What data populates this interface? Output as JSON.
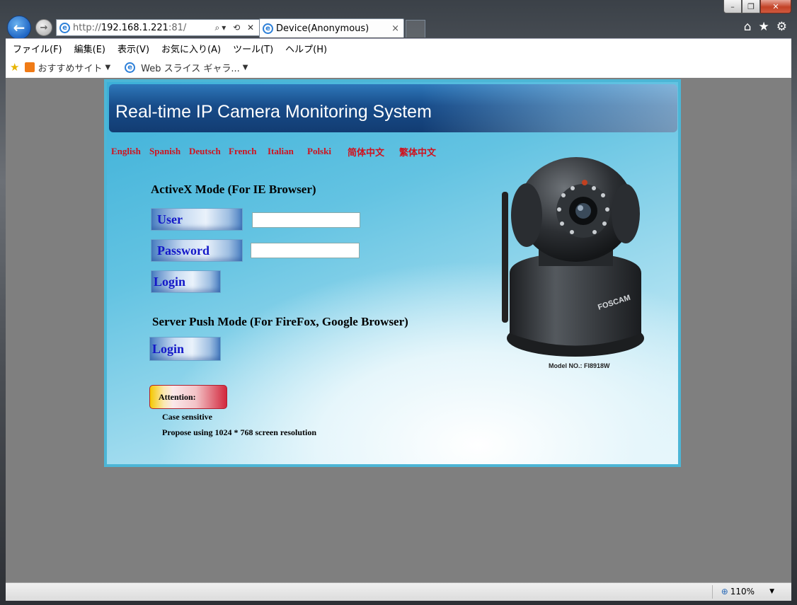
{
  "window": {
    "controls": {
      "minimize": "–",
      "restore": "❐",
      "close": "✕"
    }
  },
  "nav": {
    "address_prefix": "http://",
    "address_host": "192.168.1.221",
    "address_suffix": ":81/",
    "address_actions": "⌕▾ ⟲ ✕",
    "tab_title": "Device(Anonymous)",
    "tab_close": "×",
    "right_tools": [
      "⌂",
      "★",
      "⚙"
    ]
  },
  "menu": [
    "ファイル(F)",
    "編集(E)",
    "表示(V)",
    "お気に入り(A)",
    "ツール(T)",
    "ヘルプ(H)"
  ],
  "favorites": {
    "item1": "おすすめサイト",
    "item2": "Web スライス ギャラ..."
  },
  "page": {
    "banner_title": "Real-time IP Camera Monitoring System",
    "languages": [
      "English",
      "Spanish",
      "Deutsch",
      "French",
      "Italian",
      "Polski",
      "简体中文",
      "繁体中文"
    ],
    "activex_heading": "ActiveX Mode (For IE Browser)",
    "user_label": "User",
    "password_label": "Password",
    "user_value": "",
    "password_value": "",
    "login_label": "Login",
    "serverpush_heading": "Server Push Mode (For FireFox, Google Browser)",
    "login2_label": "Login",
    "attention_label": "Attention:",
    "note1": "Case sensitive",
    "note2": "Propose using 1024 * 768 screen resolution",
    "camera_brand": "FOSCAM",
    "camera_model": "Model NO.: FI8918W"
  },
  "status": {
    "zoom": "110%"
  },
  "colors": {
    "accent_blue": "#1f65c4",
    "lang_red": "#d0121e",
    "panel_border": "#4cb6d6",
    "button_text": "#1317c8"
  }
}
